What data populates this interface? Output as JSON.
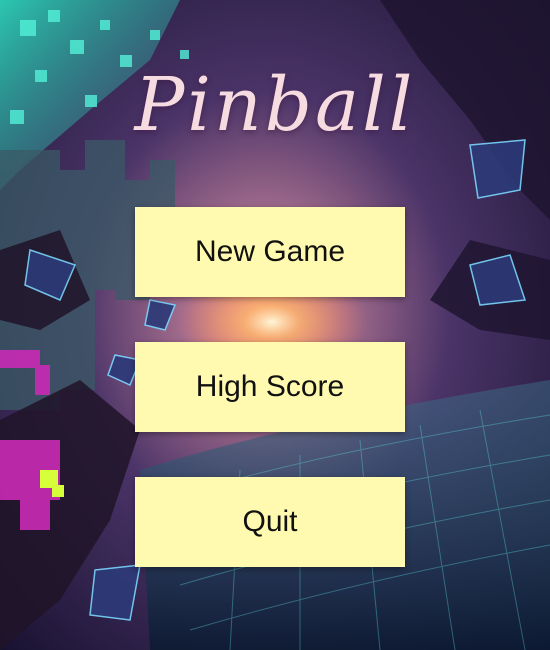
{
  "title": "Pinball",
  "menu": {
    "new_game": "New Game",
    "high_score": "High Score",
    "quit": "Quit"
  },
  "colors": {
    "button_bg": "#fffaaf",
    "button_text": "#111111",
    "title": "#f6dbe0"
  }
}
